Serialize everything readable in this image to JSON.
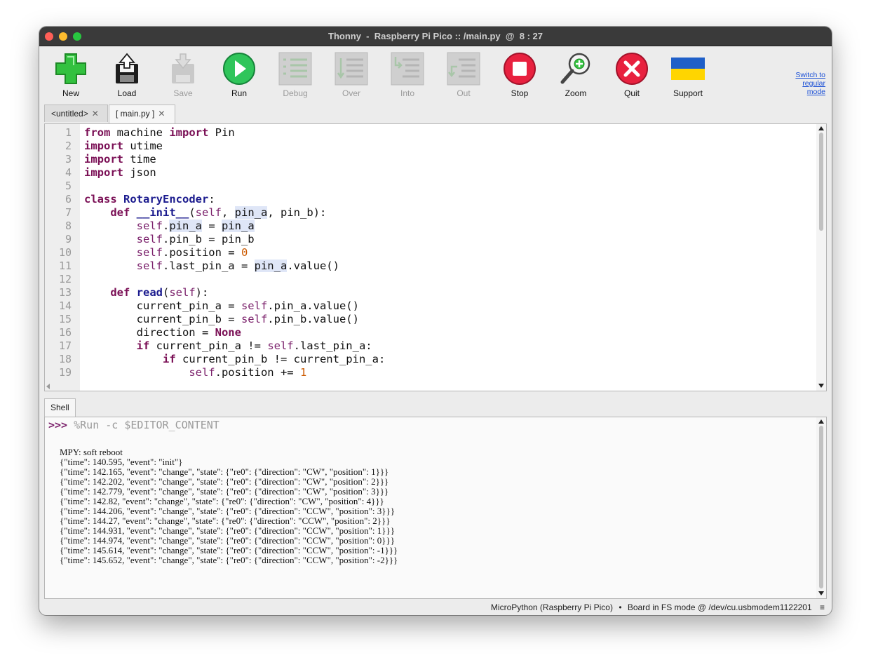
{
  "window": {
    "title": "Thonny  -  Raspberry Pi Pico :: /main.py  @  8 : 27"
  },
  "toolbar": {
    "buttons": [
      {
        "label": "New",
        "icon": "new-file-icon",
        "enabled": true
      },
      {
        "label": "Load",
        "icon": "load-icon",
        "enabled": true
      },
      {
        "label": "Save",
        "icon": "save-icon",
        "enabled": false
      },
      {
        "label": "Run",
        "icon": "run-icon",
        "enabled": true
      },
      {
        "label": "Debug",
        "icon": "debug-icon",
        "enabled": false
      },
      {
        "label": "Over",
        "icon": "step-over-icon",
        "enabled": false
      },
      {
        "label": "Into",
        "icon": "step-into-icon",
        "enabled": false
      },
      {
        "label": "Out",
        "icon": "step-out-icon",
        "enabled": false
      },
      {
        "label": "Stop",
        "icon": "stop-icon",
        "enabled": true
      },
      {
        "label": "Zoom",
        "icon": "zoom-icon",
        "enabled": true
      },
      {
        "label": "Quit",
        "icon": "quit-icon",
        "enabled": true
      },
      {
        "label": "Support",
        "icon": "ukraine-flag-icon",
        "enabled": true
      }
    ],
    "switch_mode_lines": [
      "Switch to",
      "regular",
      "mode"
    ]
  },
  "editor_tabs": [
    {
      "label": "<untitled>",
      "close": "✕"
    },
    {
      "label": "[ main.py ]",
      "close": "✕"
    }
  ],
  "editor": {
    "line_numbers": [
      "1",
      "2",
      "3",
      "4",
      "5",
      "6",
      "7",
      "8",
      "9",
      "10",
      "11",
      "12",
      "13",
      "14",
      "15",
      "16",
      "17",
      "18",
      "19"
    ],
    "lines": [
      "from machine import Pin",
      "import utime",
      "import time",
      "import json",
      "",
      "class RotaryEncoder:",
      "    def __init__(self, pin_a, pin_b):",
      "        self.pin_a = pin_a",
      "        self.pin_b = pin_b",
      "        self.position = 0",
      "        self.last_pin_a = pin_a.value()",
      "",
      "    def read(self):",
      "        current_pin_a = self.pin_a.value()",
      "        current_pin_b = self.pin_b.value()",
      "        direction = None",
      "        if current_pin_a != self.last_pin_a:",
      "            if current_pin_b != current_pin_a:",
      "                self.position += 1"
    ]
  },
  "shell": {
    "tab_label": "Shell",
    "prompt": ">>>",
    "command": "%Run -c $EDITOR_CONTENT",
    "output": [
      "MPY: soft reboot",
      "{\"time\": 140.595, \"event\": \"init\"}",
      "{\"time\": 142.165, \"event\": \"change\", \"state\": {\"re0\": {\"direction\": \"CW\", \"position\": 1}}}",
      "{\"time\": 142.202, \"event\": \"change\", \"state\": {\"re0\": {\"direction\": \"CW\", \"position\": 2}}}",
      "{\"time\": 142.779, \"event\": \"change\", \"state\": {\"re0\": {\"direction\": \"CW\", \"position\": 3}}}",
      "{\"time\": 142.82, \"event\": \"change\", \"state\": {\"re0\": {\"direction\": \"CW\", \"position\": 4}}}",
      "{\"time\": 144.206, \"event\": \"change\", \"state\": {\"re0\": {\"direction\": \"CCW\", \"position\": 3}}}",
      "{\"time\": 144.27, \"event\": \"change\", \"state\": {\"re0\": {\"direction\": \"CCW\", \"position\": 2}}}",
      "{\"time\": 144.931, \"event\": \"change\", \"state\": {\"re0\": {\"direction\": \"CCW\", \"position\": 1}}}",
      "{\"time\": 144.974, \"event\": \"change\", \"state\": {\"re0\": {\"direction\": \"CCW\", \"position\": 0}}}",
      "{\"time\": 145.614, \"event\": \"change\", \"state\": {\"re0\": {\"direction\": \"CCW\", \"position\": -1}}}",
      "{\"time\": 145.652, \"event\": \"change\", \"state\": {\"re0\": {\"direction\": \"CCW\", \"position\": -2}}}"
    ]
  },
  "status": {
    "interpreter": "MicroPython (Raspberry Pi Pico)",
    "separator": "•",
    "board": "Board in FS mode @ /dev/cu.usbmodem1122201",
    "menu_icon": "≡"
  },
  "colors": {
    "keyword": "#7a0f55",
    "name": "#1b1b8e",
    "number": "#cc5a00",
    "run_green": "#2fc55a",
    "stop_red": "#e8213f",
    "new_green": "#2fbf3a"
  }
}
